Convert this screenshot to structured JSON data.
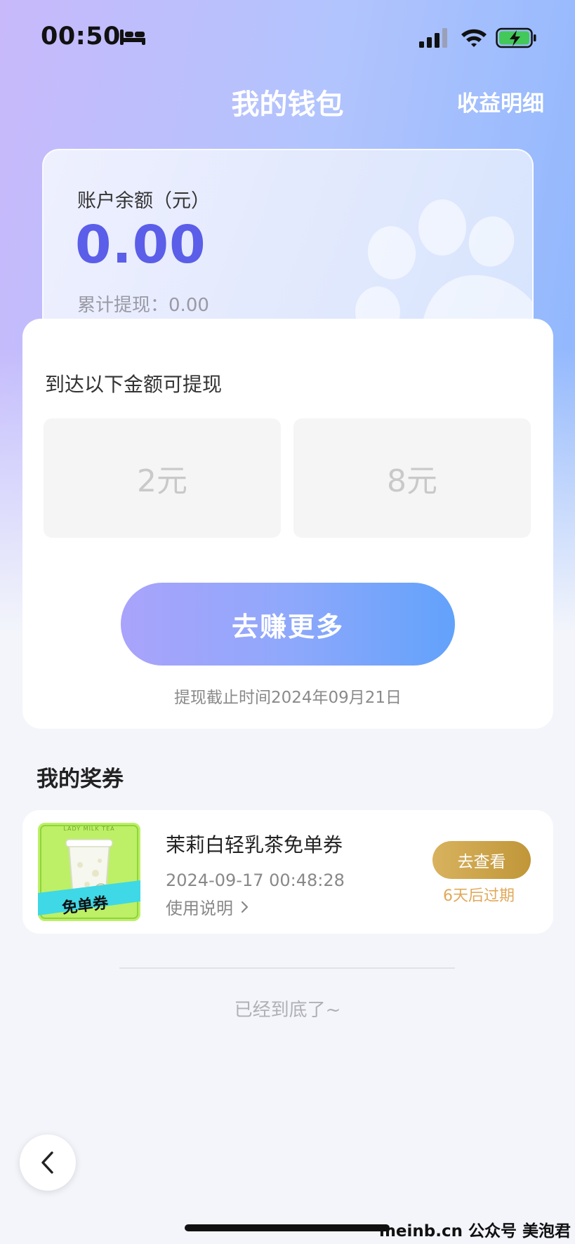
{
  "status_bar": {
    "time": "00:50"
  },
  "header": {
    "title": "我的钱包",
    "right_link": "收益明细"
  },
  "balance": {
    "label": "账户余额（元）",
    "value": "0.00",
    "withdrawn_label": "累计提现：",
    "withdrawn_value": "0.00"
  },
  "withdraw": {
    "title": "到达以下金额可提现",
    "options": [
      "2元",
      "8元"
    ],
    "button_label": "去赚更多",
    "deadline": "提现截止时间2024年09月21日"
  },
  "coupons": {
    "title": "我的奖券",
    "items": [
      {
        "name": "茉莉白轻乳茶免单券",
        "time": "2024-09-17 00:48:28",
        "usage_label": "使用说明",
        "button_label": "去查看",
        "expire_text": "6天后过期",
        "image_badge": "免单券",
        "image_header": "LADY MILK TEA"
      }
    ]
  },
  "footer": {
    "end_text": "已经到底了~"
  },
  "watermark": "meinb.cn 公众号 美泡君",
  "colors": {
    "accent": "#5b5ee8",
    "button_gradient_start": "#a9a3fb",
    "button_gradient_end": "#62a2fb",
    "gold_button": "#c9a148",
    "expire": "#e0a95a",
    "coupon_bg": "#bdf066"
  }
}
